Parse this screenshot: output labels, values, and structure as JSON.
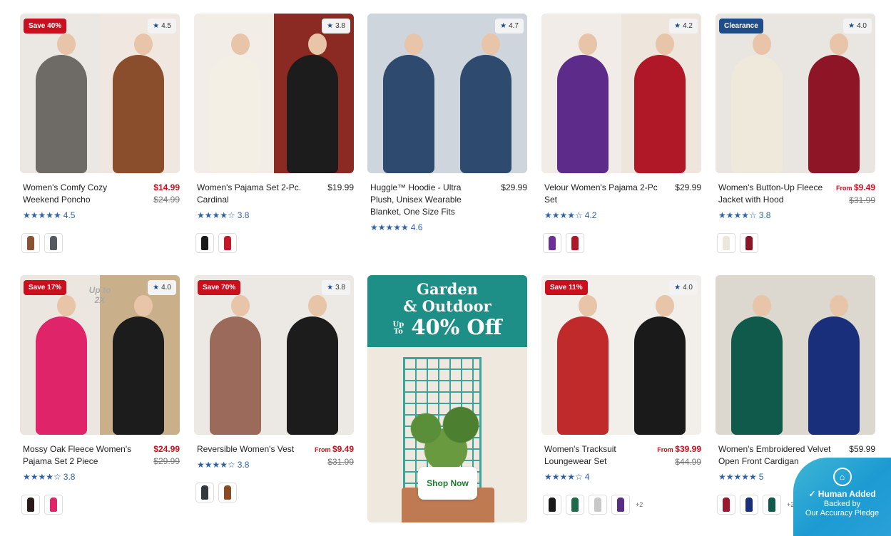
{
  "products": [
    {
      "name": "Women's Comfy Cozy Weekend Poncho",
      "badge": "Save 40%",
      "badge_type": "save",
      "rating_badge": "4.5",
      "price": "$14.99",
      "price_type": "sale",
      "orig": "$24.99",
      "stars": "★★★★★",
      "rating": "4.5",
      "swatches": [
        "#8a5232",
        "#555a5e"
      ],
      "more": ""
    },
    {
      "name": "Women's Pajama Set 2-Pc. Cardinal",
      "badge": "",
      "badge_type": "",
      "rating_badge": "3.8",
      "price": "$19.99",
      "price_type": "reg",
      "orig": "",
      "stars": "★★★★☆",
      "rating": "3.8",
      "swatches": [
        "#1a1a1a",
        "#c4182a"
      ],
      "more": ""
    },
    {
      "name": "Huggle™ Hoodie - Ultra Plush, Unisex Wearable Blanket, One Size Fits",
      "badge": "",
      "badge_type": "",
      "rating_badge": "4.7",
      "price": "$29.99",
      "price_type": "reg",
      "orig": "",
      "stars": "★★★★★",
      "rating": "4.6",
      "swatches": [],
      "more": ""
    },
    {
      "name": "Velour Women's Pajama 2-Pc Set",
      "badge": "",
      "badge_type": "",
      "rating_badge": "4.2",
      "price": "$29.99",
      "price_type": "reg",
      "orig": "",
      "stars": "★★★★☆",
      "rating": "4.2",
      "swatches": [
        "#6b2f97",
        "#b01828"
      ],
      "more": ""
    },
    {
      "name": "Women's Button-Up Fleece Jacket with Hood",
      "badge": "Clearance",
      "badge_type": "clear",
      "rating_badge": "4.0",
      "price": "$9.49",
      "price_type": "from",
      "orig": "$31.99",
      "stars": "★★★★☆",
      "rating": "3.8",
      "swatches": [
        "#ece7da",
        "#8e1526"
      ],
      "more": ""
    },
    {
      "name": "Mossy Oak Fleece Women's Pajama Set 2 Piece",
      "badge": "Save 17%",
      "badge_type": "save",
      "rating_badge": "4.0",
      "price": "$24.99",
      "price_type": "sale",
      "orig": "$29.99",
      "stars": "★★★★☆",
      "rating": "3.8",
      "swatches": [
        "#2a1a1a",
        "#e0246a"
      ],
      "more": ""
    },
    {
      "name": "Reversible Women's Vest",
      "badge": "Save 70%",
      "badge_type": "save",
      "rating_badge": "3.8",
      "price": "$9.49",
      "price_type": "from",
      "orig": "$31.99",
      "stars": "★★★★☆",
      "rating": "3.8",
      "swatches": [
        "#33383d",
        "#8a4a24"
      ],
      "more": ""
    },
    {
      "name": "Women's Tracksuit Loungewear Set",
      "badge": "Save 11%",
      "badge_type": "save",
      "rating_badge": "4.0",
      "price": "$39.99",
      "price_type": "from",
      "orig": "$44.99",
      "stars": "★★★★☆",
      "rating": "4",
      "swatches": [
        "#1a1a1a",
        "#1e6a4a",
        "#c8c8c8",
        "#5a2d84"
      ],
      "more": "+2"
    },
    {
      "name": "Women's Embroidered Velvet Open Front Cardigan",
      "badge": "",
      "badge_type": "",
      "rating_badge": "",
      "price": "$59.99",
      "price_type": "reg",
      "orig": "",
      "stars": "★★★★★",
      "rating": "5",
      "swatches": [
        "#9b1730",
        "#1a2f7c",
        "#0f5a4a"
      ],
      "more": "+2"
    }
  ],
  "promo": {
    "line1": "Garden",
    "line2": "& Outdoor",
    "up": "Up",
    "to": "To",
    "line3": "40% Off",
    "button": "Shop Now"
  },
  "overlay": {
    "title": "Human Added",
    "line1": "Backed by",
    "line2": "Our Accuracy Pledge"
  },
  "images": [
    {
      "label": "",
      "l": "#ebe7e2",
      "r": "#f0e8e0",
      "a": "#6e6a66",
      "b": "#8a4e2c"
    },
    {
      "label": "",
      "l": "#f2ede6",
      "r": "#8a2a22",
      "a": "#f4efe5",
      "b": "#1c1c1c"
    },
    {
      "label": "",
      "l": "#cfd5dc",
      "r": "#cfd5dc",
      "a": "#2e4a6e",
      "b": "#2e4a6e"
    },
    {
      "label": "",
      "l": "#f1ece7",
      "r": "#eee6dd",
      "a": "#5d2b8a",
      "b": "#b01828"
    },
    {
      "label": "",
      "l": "#e9e6e1",
      "r": "#e9e6e1",
      "a": "#efe9dc",
      "b": "#8e1526"
    },
    {
      "label": "Up to 2X",
      "l": "#ebe6e0",
      "r": "#c9b08a",
      "a": "#e0246a",
      "b": "#1c1c1c"
    },
    {
      "label": "",
      "l": "#ece9e5",
      "r": "#ece9e5",
      "a": "#9b6a5a",
      "b": "#1c1c1c"
    },
    {
      "label": "",
      "l": "#f2efeb",
      "r": "#f2efeb",
      "a": "#c02a2a",
      "b": "#1a1a1a"
    },
    {
      "label": "",
      "l": "#dcd7cf",
      "r": "#dcd7cf",
      "a": "#0f5a4a",
      "b": "#1a2f7c"
    }
  ]
}
